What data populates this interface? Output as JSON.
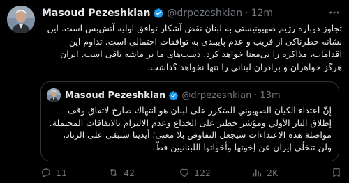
{
  "tweet": {
    "author_name": "Masoud Pezeshkian",
    "handle": "@drpezeshkian",
    "separator": "·",
    "time": "12m",
    "text": "تجاوز دوباره رژیم صهیونیستی به لبنان نقض آشکار توافق اولیه آتش‌بس است. این نشانه خطرناکی از فریب و عدم پایبندی به توافقات احتمالی است. تداوم این اقدامات، مذاکره را بی‌معنا خواهد کرد. دست‌های ما بر ماشه باقی است. ایران هرگز خواهران و برادران لبنانی را تنها نخواهد گذاشت."
  },
  "quote": {
    "author_name": "Masoud Pezeshkian",
    "handle": "@drpezeshkian",
    "separator": "·",
    "time": "13m",
    "text": "إنّ اعتداء الكيان الصهيوني المتكرر على لبنان هو انتهاك صارخ لاتفاق وقف إطلاق النار الأولي ومؤشر خطير على الخداع وعدم الالتزام بالاتفاقات المحتملة. مواصلة هذه الاعتداءات سيجعل التفاوض بلا معنى؛ أيدينا ستبقى على الزناد، ولن تتخلّى إيران عن إخوتها وأخواتها اللبنانيين قطّ."
  },
  "actions": {
    "replies": "11",
    "retweets": "42",
    "likes": "122",
    "views": "2K"
  },
  "colors": {
    "background": "#000000",
    "text": "#e7e9ea",
    "muted": "#71767b",
    "verified": "#1d9bf0",
    "border": "#2f3336"
  },
  "icons": [
    "verified-badge-icon",
    "more-icon",
    "reply-icon",
    "retweet-icon",
    "like-icon",
    "views-icon",
    "bookmark-icon"
  ]
}
